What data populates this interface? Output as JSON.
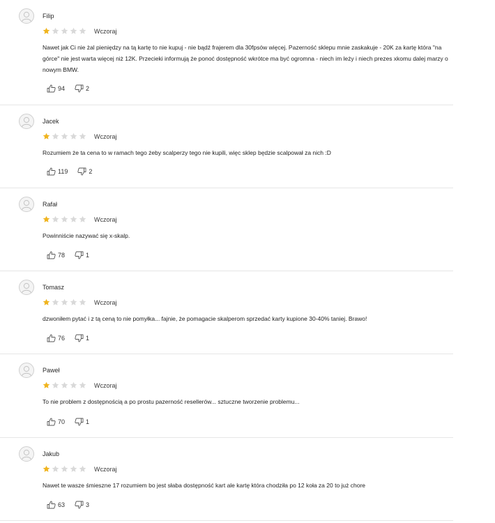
{
  "colors": {
    "star_filled": "#f0b41e",
    "star_empty": "#d9d9d9",
    "divider": "#e6e6e6"
  },
  "icons": {
    "avatar": "user-avatar-icon",
    "star": "star-icon",
    "upvote": "thumbs-up-icon",
    "downvote": "thumbs-down-icon"
  },
  "reviews": [
    {
      "author": "Filip",
      "rating": 1,
      "date": "Wczoraj",
      "text": "Nawet jak Ci nie żal pieniędzy na tą kartę to nie kupuj - nie bądź frajerem dla 30fpsów więcej. Pazerność sklepu mnie zaskakuje - 20K za kartę która \"na górce\" nie jest warta więcej niż 12K. Przecieki informują że ponoć dostępność wkrótce ma być ogromna - niech im leży i niech prezes xkomu dalej marzy o nowym BMW.",
      "upvotes": "94",
      "downvotes": "2"
    },
    {
      "author": "Jacek",
      "rating": 1,
      "date": "Wczoraj",
      "text": "Rozumiem że ta cena to w ramach tego żeby scalperzy tego nie kupili, więc sklep będzie scalpował za nich :D",
      "upvotes": "119",
      "downvotes": "2"
    },
    {
      "author": "Rafał",
      "rating": 1,
      "date": "Wczoraj",
      "text": "Powinniście nazywać się x-skalp.",
      "upvotes": "78",
      "downvotes": "1"
    },
    {
      "author": "Tomasz",
      "rating": 1,
      "date": "Wczoraj",
      "text": "dzwoniłem pytać i z tą ceną to nie pomyłka... fajnie, że pomagacie skalperom sprzedać karty kupione 30-40% taniej. Brawo!",
      "upvotes": "76",
      "downvotes": "1"
    },
    {
      "author": "Paweł",
      "rating": 1,
      "date": "Wczoraj",
      "text": "To nie problem z dostępnością a po prostu pazerność resellerów... sztuczne tworzenie problemu...",
      "upvotes": "70",
      "downvotes": "1"
    },
    {
      "author": "Jakub",
      "rating": 1,
      "date": "Wczoraj",
      "text": "Nawet te wasze śmieszne 17 rozumiem bo jest słaba dostępność kart ale kartę która chodziła po 12 koła za 20 to już chore",
      "upvotes": "63",
      "downvotes": "3"
    }
  ]
}
